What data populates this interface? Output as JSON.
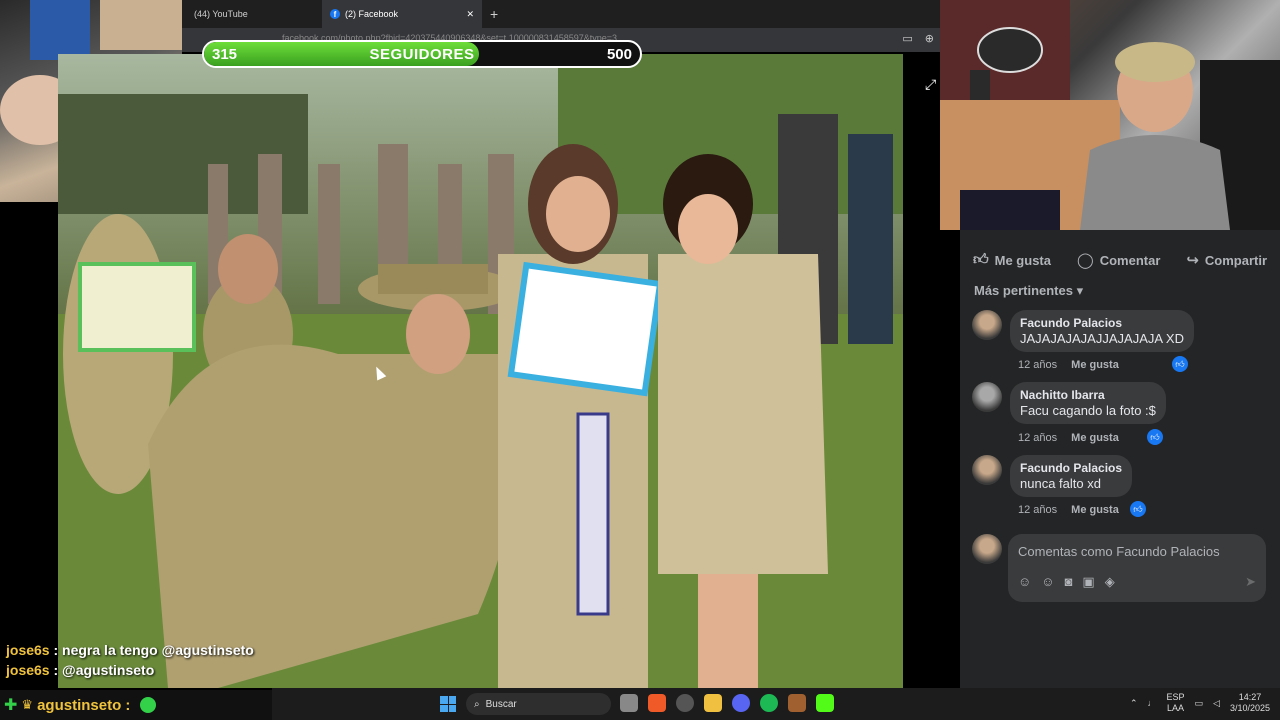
{
  "browser": {
    "tabs": [
      {
        "label": "(44) YouTube"
      },
      {
        "label": "(2) Facebook"
      }
    ],
    "url": "facebook.com/photo.php?fbid=420375440906348&set=t.100000831458597&type=3"
  },
  "stream": {
    "followers": {
      "current": "315",
      "label": "SEGUIDORES",
      "goal": "500",
      "progress": 0.63
    },
    "chat": [
      {
        "user": "jose6s",
        "text": ": negra la tengo @agustinseto"
      },
      {
        "user": "jose6s",
        "text": ": @agustinseto"
      }
    ],
    "chat_input_user": "agustinseto :"
  },
  "facebook": {
    "actions": {
      "like": "Me gusta",
      "comment": "Comentar",
      "share": "Compartir"
    },
    "relevance": "Más pertinentes",
    "comments": [
      {
        "author": "Facundo Palacios",
        "text": "JAJAJAJAJAJJAJAJAJA XD",
        "time": "12 años",
        "like": "Me gusta"
      },
      {
        "author": "Nachitto Ibarra",
        "text": "Facu cagando la foto :$",
        "time": "12 años",
        "like": "Me gusta"
      },
      {
        "author": "Facundo Palacios",
        "text": "nunca falto xd",
        "time": "12 años",
        "like": "Me gusta"
      }
    ],
    "composer_placeholder": "Comentas como Facundo Palacios"
  },
  "taskbar": {
    "search": "Buscar",
    "lang_top": "ESP",
    "lang_bottom": "LAA",
    "time": "14:27",
    "date": "3/10/2025"
  },
  "colors": {
    "fb_bg": "#242526",
    "fb_bubble": "#3a3b3c",
    "fb_blue": "#1877f2",
    "bar_green": "#4cc02a"
  }
}
